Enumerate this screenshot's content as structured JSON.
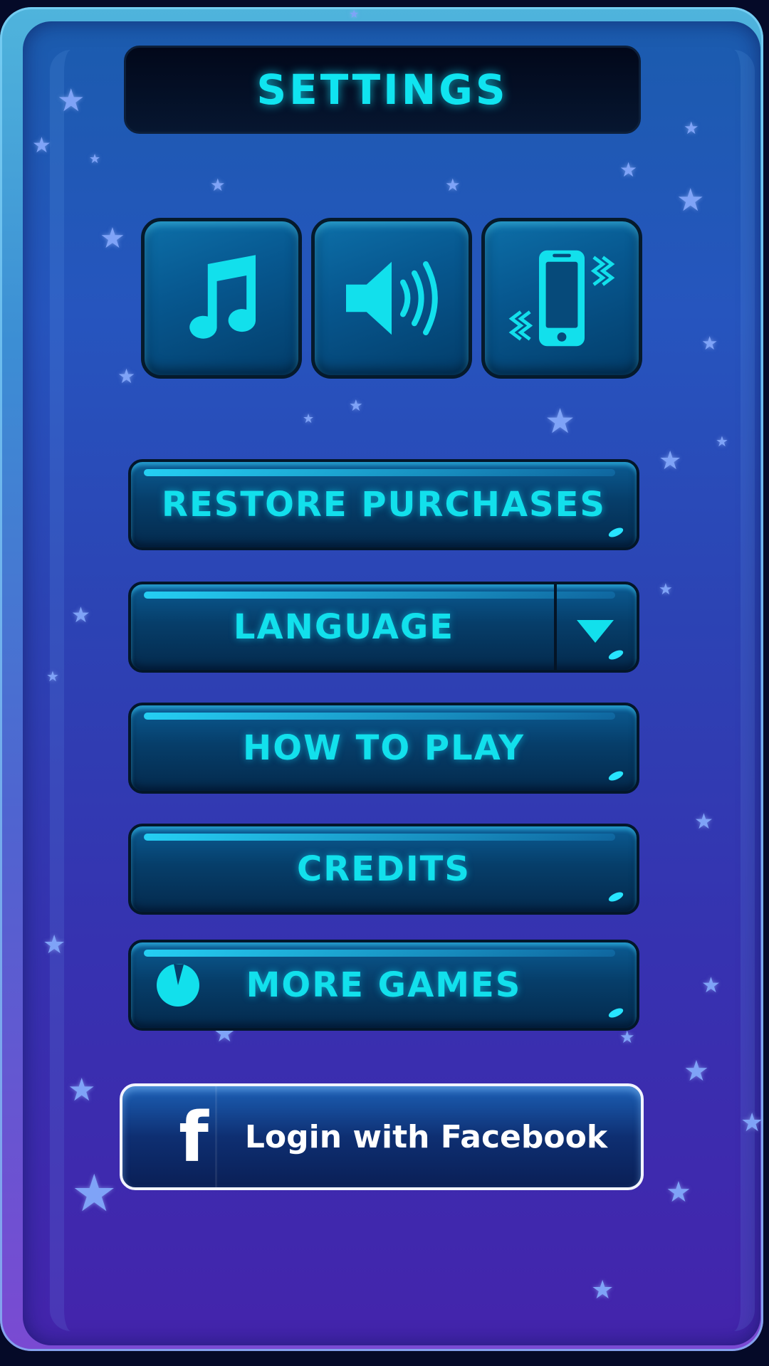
{
  "header": {
    "title": "SETTINGS"
  },
  "toggles": [
    {
      "name": "music",
      "icon": "music-note-icon"
    },
    {
      "name": "sound",
      "icon": "speaker-icon"
    },
    {
      "name": "vibration",
      "icon": "phone-vibrate-icon"
    }
  ],
  "menu": {
    "restore_label": "RESTORE PURCHASES",
    "language_label": "LANGUAGE",
    "how_to_play_label": "HOW TO PLAY",
    "credits_label": "CREDITS",
    "more_games_label": "MORE GAMES"
  },
  "facebook": {
    "label": "Login with Facebook",
    "icon_glyph": "f"
  },
  "colors": {
    "accent": "#12e0ec",
    "panel_top": "#1b5cae",
    "panel_bottom": "#4424ac",
    "facebook_border": "#f2f4ff"
  }
}
